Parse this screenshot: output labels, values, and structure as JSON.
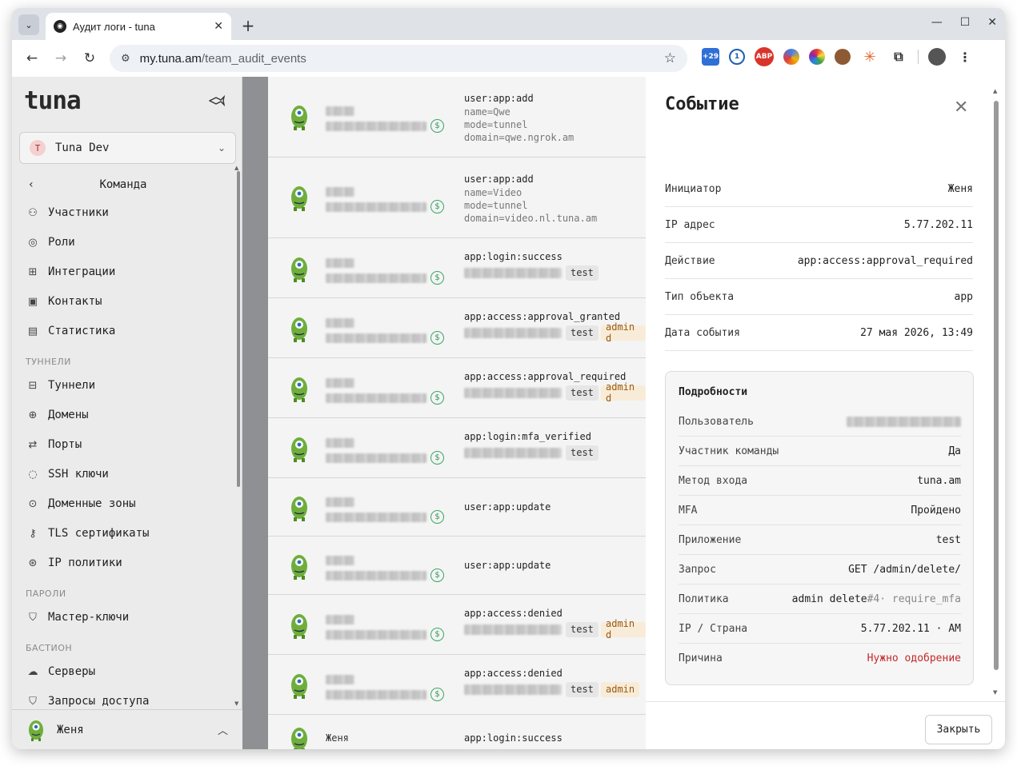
{
  "browser": {
    "tab_title": "Аудит логи - tuna",
    "url_host": "my.tuna.am",
    "url_path": "/team_audit_events",
    "ext_badge": "+29",
    "ext_abp": "ABP"
  },
  "sidebar": {
    "logo": "tuna",
    "team": {
      "initial": "T",
      "name": "Tuna Dev"
    },
    "back_label": "Команда",
    "items_team": [
      {
        "label": "Участники",
        "icon": "users-icon"
      },
      {
        "label": "Роли",
        "icon": "user-circle-icon"
      },
      {
        "label": "Интеграции",
        "icon": "puzzle-icon"
      },
      {
        "label": "Контакты",
        "icon": "contact-icon"
      },
      {
        "label": "Статистика",
        "icon": "chart-icon"
      }
    ],
    "section_tunnels": "ТУННЕЛИ",
    "items_tunnels": [
      {
        "label": "Туннели",
        "icon": "tunnel-icon"
      },
      {
        "label": "Домены",
        "icon": "globe-icon"
      },
      {
        "label": "Порты",
        "icon": "swap-icon"
      },
      {
        "label": "SSH ключи",
        "icon": "fingerprint-icon"
      },
      {
        "label": "Доменные зоны",
        "icon": "pin-icon"
      },
      {
        "label": "TLS сертификаты",
        "icon": "key-icon"
      },
      {
        "label": "IP политики",
        "icon": "globe-lock-icon"
      }
    ],
    "section_passwords": "ПАРОЛИ",
    "items_passwords": [
      {
        "label": "Мастер-ключи",
        "icon": "shield-check-icon"
      }
    ],
    "section_bastion": "БАСТИОН",
    "items_bastion": [
      {
        "label": "Серверы",
        "icon": "cloud-icon"
      },
      {
        "label": "Запросы доступа",
        "icon": "shield-icon"
      }
    ],
    "user_name": "Женя"
  },
  "events": [
    {
      "action": "user:app:add",
      "params": [
        "name=Qwe",
        "mode=tunnel",
        "domain=qwe.ngrok.am"
      ],
      "tags": []
    },
    {
      "action": "user:app:add",
      "params": [
        "name=Video",
        "mode=tunnel",
        "domain=video.nl.tuna.am"
      ],
      "tags": []
    },
    {
      "action": "app:login:success",
      "params": [],
      "tags": [
        "test"
      ]
    },
    {
      "action": "app:access:approval_granted",
      "params": [],
      "tags": [
        "test",
        "admin d"
      ]
    },
    {
      "action": "app:access:approval_required",
      "params": [],
      "tags": [
        "test",
        "admin d"
      ]
    },
    {
      "action": "app:login:mfa_verified",
      "params": [],
      "tags": [
        "test"
      ]
    },
    {
      "action": "user:app:update",
      "params": [],
      "tags": []
    },
    {
      "action": "user:app:update",
      "params": [],
      "tags": []
    },
    {
      "action": "app:access:denied",
      "params": [],
      "tags": [
        "test",
        "admin d"
      ]
    },
    {
      "action": "app:access:denied",
      "params": [],
      "tags": [
        "test",
        "admin"
      ]
    },
    {
      "action": "app:login:success",
      "initiator": "Женя",
      "params": [],
      "tags": []
    }
  ],
  "drawer": {
    "title": "Событие",
    "rows": [
      {
        "key": "Инициатор",
        "value": "Женя"
      },
      {
        "key": "IP адрес",
        "value": "5.77.202.11"
      },
      {
        "key": "Действие",
        "value": "app:access:approval_required"
      },
      {
        "key": "Тип объекта",
        "value": "app"
      },
      {
        "key": "Дата события",
        "value": "27 мая 2026, 13:49"
      }
    ],
    "details_title": "Подробности",
    "details": {
      "user_key": "Пользователь",
      "member_key": "Участник команды",
      "member_val": "Да",
      "login_key": "Метод входа",
      "login_val": "tuna.am",
      "mfa_key": "MFA",
      "mfa_val": "Пройдено",
      "app_key": "Приложение",
      "app_val": "test",
      "request_key": "Запрос",
      "request_val": "GET /admin/delete/",
      "policy_key": "Политика",
      "policy_name": "admin delete",
      "policy_id": "#4",
      "policy_sep": "·",
      "policy_rule": "require_mfa",
      "geo_key": "IP / Страна",
      "geo_val": "5.77.202.11 · AM",
      "reason_key": "Причина",
      "reason_val": "Нужно одобрение"
    },
    "close_label": "Закрыть"
  },
  "colors": {
    "accent_green": "#2d9a56",
    "danger": "#c62828",
    "policy_tag": "#9a5a10"
  }
}
